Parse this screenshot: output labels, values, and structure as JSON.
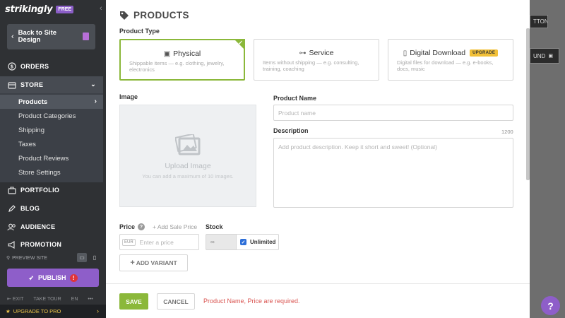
{
  "sidebar": {
    "logo": "strikingly",
    "plan_badge": "FREE",
    "back_label": "Back to Site Design",
    "orders": "ORDERS",
    "store": "STORE",
    "store_items": [
      "Products",
      "Product Categories",
      "Shipping",
      "Taxes",
      "Product Reviews",
      "Store Settings"
    ],
    "portfolio": "PORTFOLIO",
    "blog": "BLOG",
    "audience": "AUDIENCE",
    "promotion": "PROMOTION",
    "preview_site": "PREVIEW SITE",
    "publish": "PUBLISH",
    "publish_alert": "!",
    "exit": "EXIT",
    "take_tour": "TAKE TOUR",
    "language": "EN",
    "more": "•••",
    "upgrade": "UPGRADE TO PRO"
  },
  "background": {
    "button_1": "TTON",
    "button_2": "UND"
  },
  "modal": {
    "title": "PRODUCTS",
    "product_type_label": "Product Type",
    "types": [
      {
        "title": "Physical",
        "desc": "Shippable items — e.g. clothing, jewelry, electronics",
        "selected": true
      },
      {
        "title": "Service",
        "desc": "Items without shipping — e.g. consulting, training, coaching",
        "selected": false
      },
      {
        "title": "Digital Download",
        "desc": "Digital files for download — e.g. e-books, docs, music",
        "selected": false,
        "badge": "UPGRADE"
      }
    ],
    "image_label": "Image",
    "upload_title": "Upload Image",
    "upload_sub": "You can add a maximum of 10 images.",
    "product_name_label": "Product Name",
    "product_name_placeholder": "Product name",
    "description_label": "Description",
    "description_count": "1200",
    "description_placeholder": "Add product description. Keep it short and sweet! (Optional)",
    "price_label": "Price",
    "sale_price_link": "+ Add Sale Price",
    "currency": "EUR",
    "price_placeholder": "Enter a price",
    "stock_label": "Stock",
    "stock_value": "∞",
    "unlimited_label": "Unlimited",
    "unlimited_checked": true,
    "add_variant": "ADD VARIANT",
    "save": "SAVE",
    "cancel": "CANCEL",
    "error": "Product Name, Price are required."
  },
  "help_icon": "?",
  "colors": {
    "accent_green": "#8bb83a",
    "brand_purple": "#8e5ec9",
    "error_red": "#d9534f"
  }
}
